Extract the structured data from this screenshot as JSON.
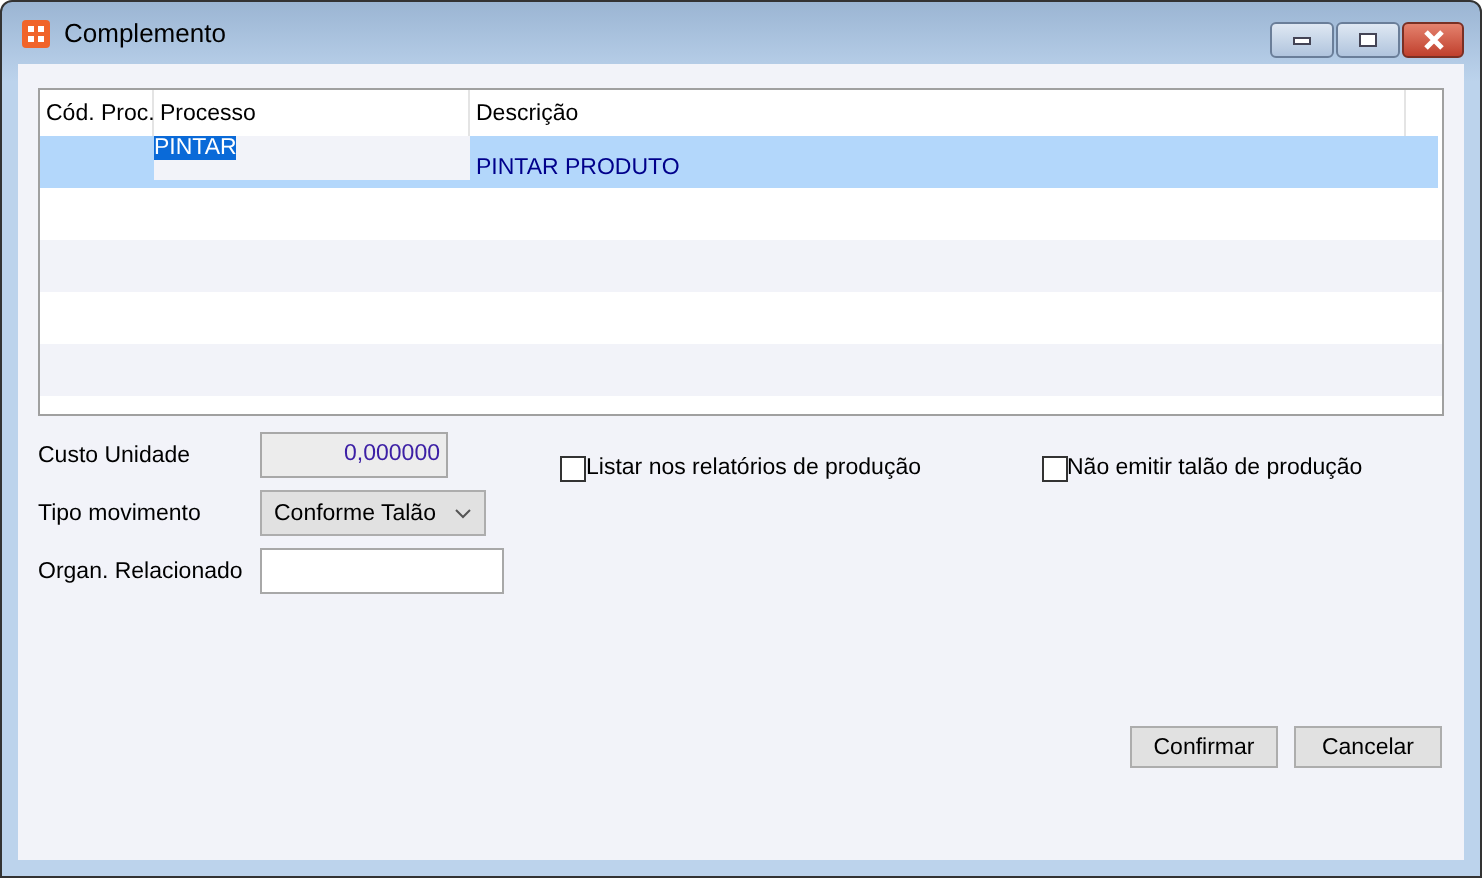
{
  "window": {
    "title": "Complemento"
  },
  "table": {
    "columns": [
      "Cód. Proc.",
      "Processo",
      "Descrição"
    ],
    "rows": [
      {
        "cells": [
          "",
          "PINTAR",
          "PINTAR PRODUTO"
        ],
        "selected": true
      }
    ]
  },
  "fields": {
    "custo_unidade": {
      "label": "Custo Unidade",
      "value": "0,000000"
    },
    "tipo_movimento": {
      "label": "Tipo movimento",
      "value": "Conforme Talão"
    },
    "organ_relacionado": {
      "label": "Organ. Relacionado"
    }
  },
  "checkboxes": [
    {
      "label": "Listar nos relatórios de produção",
      "checked": false
    },
    {
      "label": "Não emitir talão de produção",
      "checked": false
    }
  ],
  "buttons": [
    "Confirmar",
    "Cancelar"
  ]
}
